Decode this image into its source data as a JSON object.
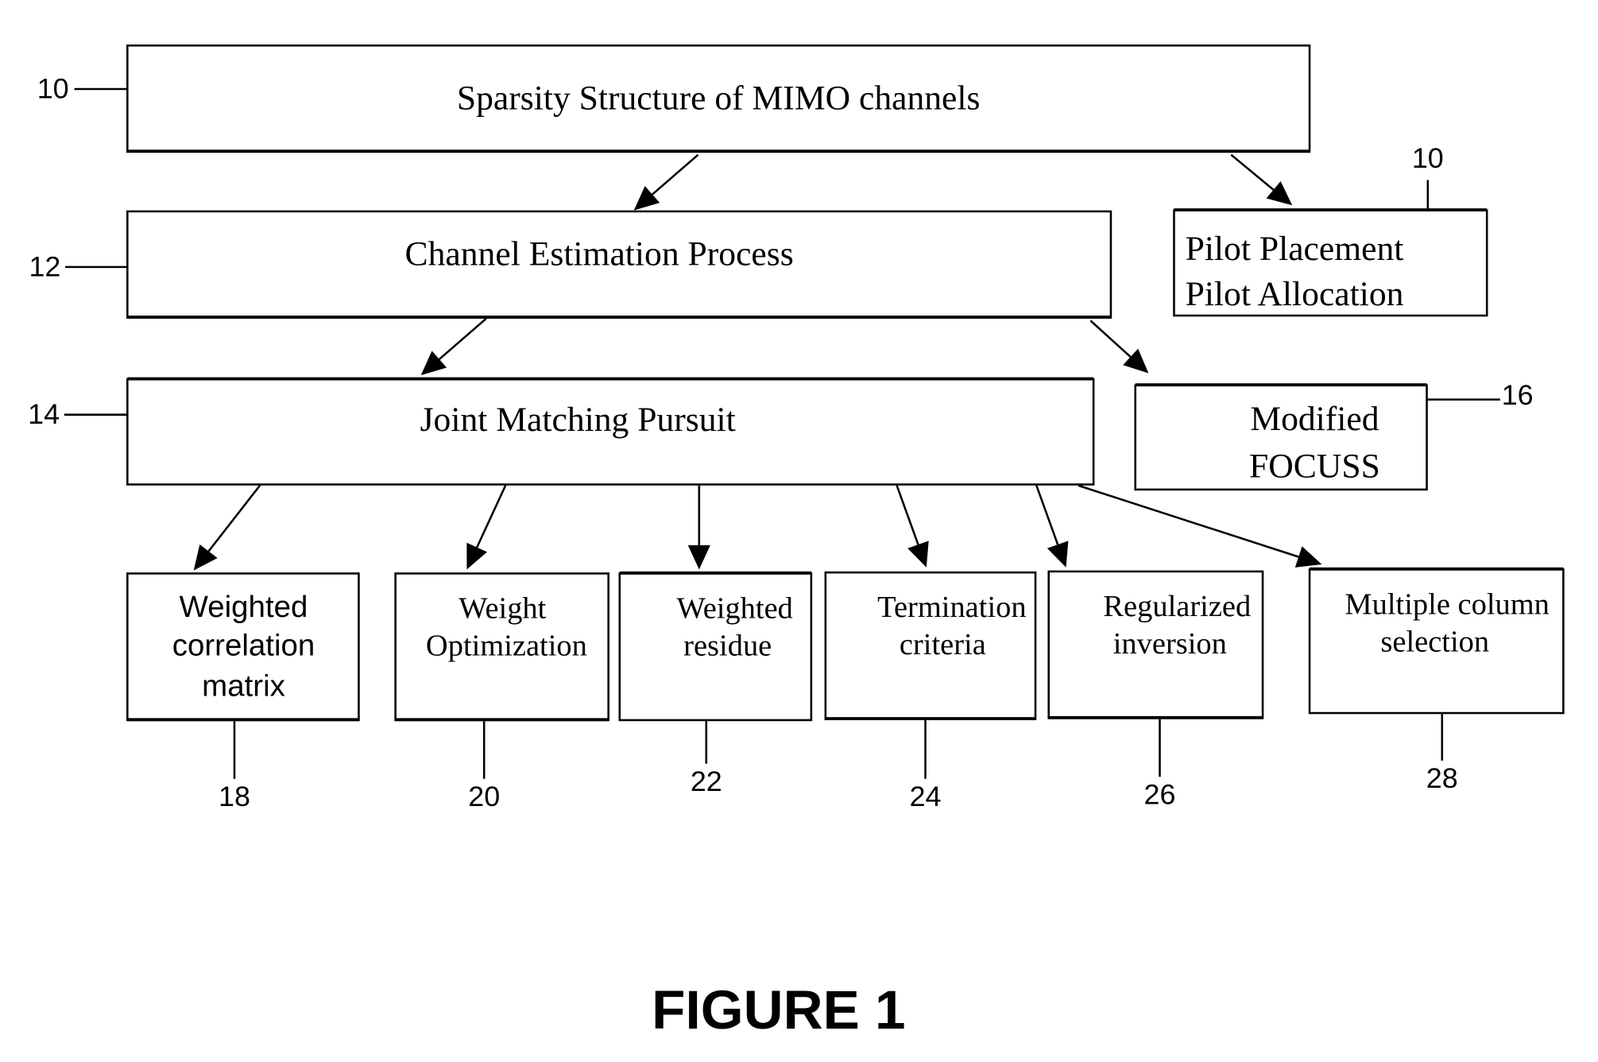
{
  "figure": {
    "title": "FIGURE 1"
  },
  "nodes": [
    {
      "id": "sparsity",
      "ref": "10",
      "lines": [
        "Sparsity Structure of MIMO channels"
      ]
    },
    {
      "id": "channel-estimation",
      "ref": "12",
      "lines": [
        "Channel Estimation Process"
      ]
    },
    {
      "id": "pilot",
      "ref": "10",
      "lines": [
        "Pilot Placement",
        "Pilot Allocation"
      ]
    },
    {
      "id": "jmp",
      "ref": "14",
      "lines": [
        "Joint Matching Pursuit"
      ]
    },
    {
      "id": "focuss",
      "ref": "16",
      "lines": [
        "Modified",
        "FOCUSS"
      ]
    },
    {
      "id": "weighted-correlation",
      "ref": "18",
      "lines": [
        "Weighted",
        "correlation",
        "matrix"
      ]
    },
    {
      "id": "weight-optimization",
      "ref": "20",
      "lines": [
        "Weight",
        "Optimization"
      ]
    },
    {
      "id": "weighted-residue",
      "ref": "22",
      "lines": [
        "Weighted",
        "residue"
      ]
    },
    {
      "id": "termination",
      "ref": "24",
      "lines": [
        "Termination",
        "criteria"
      ]
    },
    {
      "id": "regularized",
      "ref": "26",
      "lines": [
        "Regularized",
        "inversion"
      ]
    },
    {
      "id": "multiple-column",
      "ref": "28",
      "lines": [
        "Multiple column",
        "selection"
      ]
    }
  ],
  "edges": [
    {
      "from": "sparsity",
      "to": "channel-estimation"
    },
    {
      "from": "sparsity",
      "to": "pilot"
    },
    {
      "from": "channel-estimation",
      "to": "jmp"
    },
    {
      "from": "channel-estimation",
      "to": "focuss"
    },
    {
      "from": "jmp",
      "to": "weighted-correlation"
    },
    {
      "from": "jmp",
      "to": "weight-optimization"
    },
    {
      "from": "jmp",
      "to": "weighted-residue"
    },
    {
      "from": "jmp",
      "to": "termination"
    },
    {
      "from": "jmp",
      "to": "regularized"
    },
    {
      "from": "jmp",
      "to": "multiple-column"
    }
  ]
}
